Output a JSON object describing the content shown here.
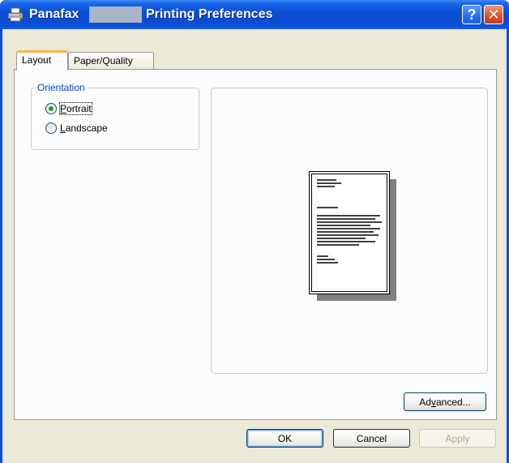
{
  "window": {
    "title_prefix": "Panafax",
    "title_suffix": "Printing Preferences",
    "help_glyph": "?",
    "close_glyph": "✕"
  },
  "tabs": [
    {
      "label": "Layout",
      "selected": true
    },
    {
      "label": "Paper/Quality",
      "selected": false
    }
  ],
  "orientation": {
    "legend": "Orientation",
    "options": [
      {
        "label": "Portrait",
        "selected": true
      },
      {
        "label": "Landscape",
        "selected": false
      }
    ]
  },
  "buttons": {
    "advanced_pre": "Ad",
    "advanced_u": "v",
    "advanced_post": "anced...",
    "ok": "OK",
    "cancel": "Cancel",
    "apply": "Apply"
  },
  "colors": {
    "titlebar": "#0a4fd6",
    "client_bg": "#ece9d8",
    "legend": "#0046d5",
    "radio_dot": "#21a121"
  }
}
